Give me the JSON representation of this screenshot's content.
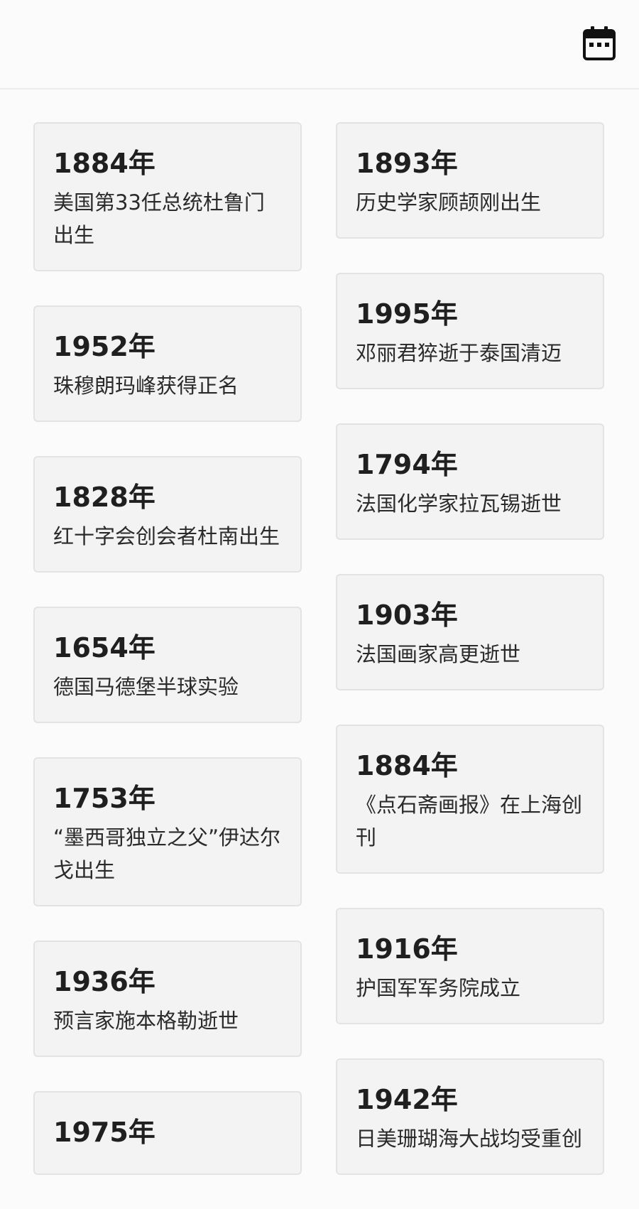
{
  "header": {
    "calendar_icon": "calendar-icon"
  },
  "left_column": [
    {
      "year": "1884年",
      "text": "美国第33任总统杜鲁门出生"
    },
    {
      "year": "1952年",
      "text": "珠穆朗玛峰获得正名"
    },
    {
      "year": "1828年",
      "text": "红十字会创会者杜南出生"
    },
    {
      "year": "1654年",
      "text": "德国马德堡半球实验"
    },
    {
      "year": "1753年",
      "text": "“墨西哥独立之父”伊达尔戈出生"
    },
    {
      "year": "1936年",
      "text": "预言家施本格勒逝世"
    },
    {
      "year": "1975年",
      "text": ""
    }
  ],
  "right_column": [
    {
      "year": "1893年",
      "text": "历史学家顾颉刚出生"
    },
    {
      "year": "1995年",
      "text": "邓丽君猝逝于泰国清迈"
    },
    {
      "year": "1794年",
      "text": "法国化学家拉瓦锡逝世"
    },
    {
      "year": "1903年",
      "text": "法国画家高更逝世"
    },
    {
      "year": "1884年",
      "text": "《点石斋画报》在上海创刊"
    },
    {
      "year": "1916年",
      "text": "护国军军务院成立"
    },
    {
      "year": "1942年",
      "text": "日美珊瑚海大战均受重创"
    }
  ]
}
